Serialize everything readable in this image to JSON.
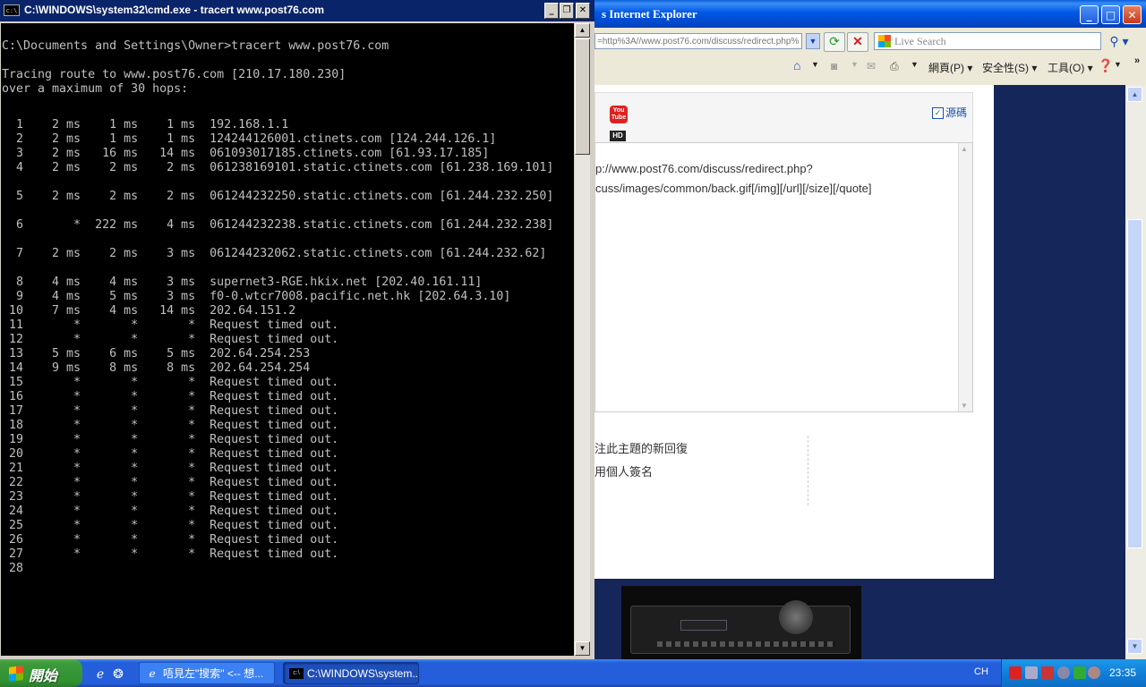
{
  "ie": {
    "title": "s Internet Explorer",
    "address_value": "=http%3A//www.post76.com/discuss/redirect.php%",
    "search_placeholder": "Live Search",
    "commands": [
      "網頁(P)",
      "安全性(S)",
      "工具(O)"
    ],
    "source_label": "源碼",
    "yt_label": "You Tube",
    "hd_label": "HD",
    "textarea_lines": [
      "p://www.post76.com/discuss/redirect.php?",
      "cuss/images/common/back.gif[/img][/url][/size][/quote]"
    ],
    "options": [
      "注此主題的新回復",
      "用個人簽名"
    ]
  },
  "cmd": {
    "title": "C:\\WINDOWS\\system32\\cmd.exe - tracert www.post76.com",
    "icon_text": "c:\\",
    "prompt": "C:\\Documents and Settings\\Owner>tracert www.post76.com",
    "trace_header": "Tracing route to www.post76.com [210.17.180.230]",
    "trace_subheader": "over a maximum of 30 hops:",
    "hops": [
      {
        "n": "1",
        "t1": "2 ms",
        "t2": "1 ms",
        "t3": "1 ms",
        "host": "192.168.1.1"
      },
      {
        "n": "2",
        "t1": "2 ms",
        "t2": "1 ms",
        "t3": "1 ms",
        "host": "124244126001.ctinets.com [124.244.126.1]"
      },
      {
        "n": "3",
        "t1": "2 ms",
        "t2": "16 ms",
        "t3": "14 ms",
        "host": "061093017185.ctinets.com [61.93.17.185]"
      },
      {
        "n": "4",
        "t1": "2 ms",
        "t2": "2 ms",
        "t3": "2 ms",
        "host": "061238169101.static.ctinets.com [61.238.169.101]"
      },
      {
        "n": "5",
        "t1": "2 ms",
        "t2": "2 ms",
        "t3": "2 ms",
        "host": "061244232250.static.ctinets.com [61.244.232.250]"
      },
      {
        "n": "6",
        "t1": "*",
        "t2": "222 ms",
        "t3": "4 ms",
        "host": "061244232238.static.ctinets.com [61.244.232.238]"
      },
      {
        "n": "7",
        "t1": "2 ms",
        "t2": "2 ms",
        "t3": "3 ms",
        "host": "061244232062.static.ctinets.com [61.244.232.62]"
      },
      {
        "n": "8",
        "t1": "4 ms",
        "t2": "4 ms",
        "t3": "3 ms",
        "host": "supernet3-RGE.hkix.net [202.40.161.11]"
      },
      {
        "n": "9",
        "t1": "4 ms",
        "t2": "5 ms",
        "t3": "3 ms",
        "host": "f0-0.wtcr7008.pacific.net.hk [202.64.3.10]"
      },
      {
        "n": "10",
        "t1": "7 ms",
        "t2": "4 ms",
        "t3": "14 ms",
        "host": "202.64.151.2"
      },
      {
        "n": "11",
        "t1": "*",
        "t2": "*",
        "t3": "*",
        "host": "Request timed out."
      },
      {
        "n": "12",
        "t1": "*",
        "t2": "*",
        "t3": "*",
        "host": "Request timed out."
      },
      {
        "n": "13",
        "t1": "5 ms",
        "t2": "6 ms",
        "t3": "5 ms",
        "host": "202.64.254.253"
      },
      {
        "n": "14",
        "t1": "9 ms",
        "t2": "8 ms",
        "t3": "8 ms",
        "host": "202.64.254.254"
      },
      {
        "n": "15",
        "t1": "*",
        "t2": "*",
        "t3": "*",
        "host": "Request timed out."
      },
      {
        "n": "16",
        "t1": "*",
        "t2": "*",
        "t3": "*",
        "host": "Request timed out."
      },
      {
        "n": "17",
        "t1": "*",
        "t2": "*",
        "t3": "*",
        "host": "Request timed out."
      },
      {
        "n": "18",
        "t1": "*",
        "t2": "*",
        "t3": "*",
        "host": "Request timed out."
      },
      {
        "n": "19",
        "t1": "*",
        "t2": "*",
        "t3": "*",
        "host": "Request timed out."
      },
      {
        "n": "20",
        "t1": "*",
        "t2": "*",
        "t3": "*",
        "host": "Request timed out."
      },
      {
        "n": "21",
        "t1": "*",
        "t2": "*",
        "t3": "*",
        "host": "Request timed out."
      },
      {
        "n": "22",
        "t1": "*",
        "t2": "*",
        "t3": "*",
        "host": "Request timed out."
      },
      {
        "n": "23",
        "t1": "*",
        "t2": "*",
        "t3": "*",
        "host": "Request timed out."
      },
      {
        "n": "24",
        "t1": "*",
        "t2": "*",
        "t3": "*",
        "host": "Request timed out."
      },
      {
        "n": "25",
        "t1": "*",
        "t2": "*",
        "t3": "*",
        "host": "Request timed out."
      },
      {
        "n": "26",
        "t1": "*",
        "t2": "*",
        "t3": "*",
        "host": "Request timed out."
      },
      {
        "n": "27",
        "t1": "*",
        "t2": "*",
        "t3": "*",
        "host": "Request timed out."
      },
      {
        "n": "28",
        "t1": "",
        "t2": "",
        "t3": "",
        "host": ""
      }
    ]
  },
  "taskbar": {
    "start_label": "開始",
    "tasks": [
      {
        "label": "唔見左\"搜索\" <-- 想...",
        "icon": "ie-icon"
      },
      {
        "label": "C:\\WINDOWS\\system...",
        "icon": "cmd-icon"
      }
    ],
    "ime": "CH",
    "clock": "23:35"
  }
}
